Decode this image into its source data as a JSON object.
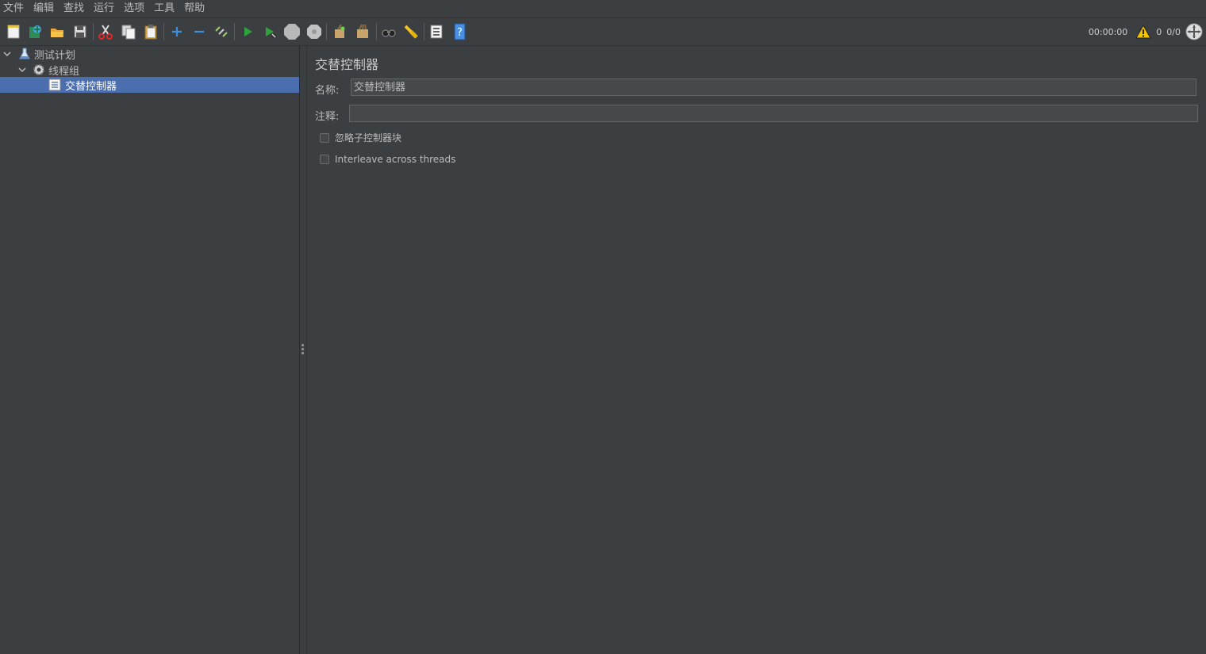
{
  "menu": [
    "文件",
    "编辑",
    "查找",
    "运行",
    "选项",
    "工具",
    "帮助"
  ],
  "toolbar": {
    "buttons": [
      {
        "name": "new-icon"
      },
      {
        "name": "templates-icon"
      },
      {
        "name": "open-icon"
      },
      {
        "name": "save-icon"
      },
      {
        "name": "cut-icon"
      },
      {
        "name": "copy-icon"
      },
      {
        "name": "paste-icon"
      },
      {
        "name": "expand-icon"
      },
      {
        "name": "collapse-icon"
      },
      {
        "name": "toggle-icon"
      },
      {
        "name": "start-icon"
      },
      {
        "name": "start-no-pause-icon"
      },
      {
        "name": "stop-icon"
      },
      {
        "name": "shutdown-icon"
      },
      {
        "name": "clear-icon"
      },
      {
        "name": "clear-all-icon"
      },
      {
        "name": "search-icon"
      },
      {
        "name": "reset-search-icon"
      },
      {
        "name": "function-helper-icon"
      },
      {
        "name": "help-icon"
      }
    ],
    "timer": "00:00:00",
    "warning_count": "0",
    "threads": "0/0"
  },
  "tree": {
    "items": [
      {
        "label": "测试计划",
        "icon": "flask-icon"
      },
      {
        "label": "线程组",
        "icon": "gear-icon"
      },
      {
        "label": "交替控制器",
        "icon": "controller-icon"
      }
    ]
  },
  "panel": {
    "title": "交替控制器",
    "name_label": "名称:",
    "name_value": "交替控制器",
    "comment_label": "注释:",
    "comment_value": "",
    "checkbox_ignore": "忽略子控制器块",
    "checkbox_interleave": "Interleave across threads"
  },
  "colors": {
    "background": "#3c3f41",
    "selection": "#4b6eaf",
    "input_bg": "#45494a",
    "text": "#bbbbbb"
  }
}
